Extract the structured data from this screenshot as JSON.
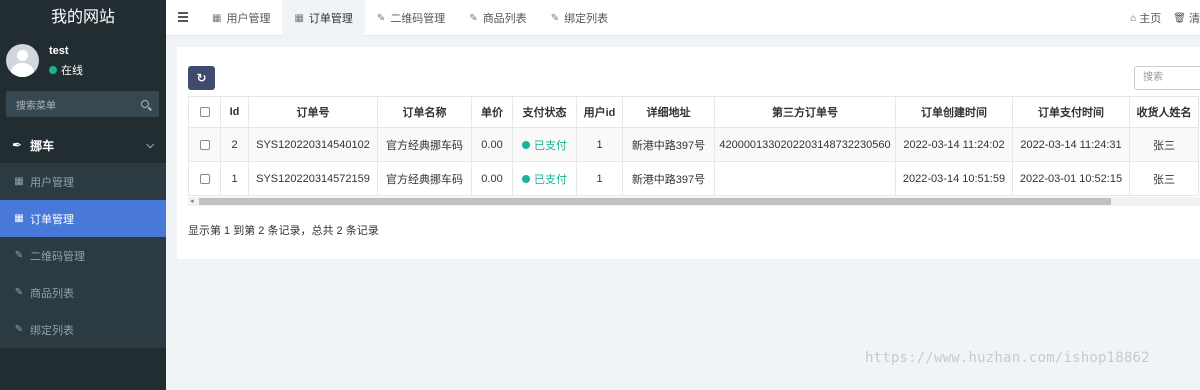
{
  "sidebar": {
    "site_title": "我的网站",
    "user": {
      "name": "test",
      "status": "在线"
    },
    "search_placeholder": "搜索菜单",
    "menu_group": "挪车",
    "items": [
      {
        "label": "用户管理",
        "icon": "table-icon"
      },
      {
        "label": "订单管理",
        "icon": "table-icon",
        "active": true
      },
      {
        "label": "二维码管理",
        "icon": "edit-icon"
      },
      {
        "label": "商品列表",
        "icon": "edit-icon"
      },
      {
        "label": "绑定列表",
        "icon": "edit-icon"
      }
    ]
  },
  "topbar": {
    "tabs": [
      {
        "label": "用户管理",
        "icon": "table-icon"
      },
      {
        "label": "订单管理",
        "icon": "table-icon",
        "active": true
      },
      {
        "label": "二维码管理",
        "icon": "edit-icon"
      },
      {
        "label": "商品列表",
        "icon": "edit-icon"
      },
      {
        "label": "绑定列表",
        "icon": "edit-icon"
      }
    ],
    "home_label": "主页",
    "clear_label": "清"
  },
  "toolbar": {
    "search_placeholder": "搜索"
  },
  "table": {
    "columns": [
      "Id",
      "订单号",
      "订单名称",
      "单价",
      "支付状态",
      "用户id",
      "详细地址",
      "第三方订单号",
      "订单创建时间",
      "订单支付时间",
      "收货人姓名"
    ],
    "rows": [
      [
        "2",
        "SYS120220314540102",
        "官方经典挪车码",
        "0.00",
        "已支付",
        "1",
        "新港中路397号",
        "4200001330202203148732230560",
        "2022-03-14 11:24:02",
        "2022-03-14 11:24:31",
        "张三"
      ],
      [
        "1",
        "SYS120220314572159",
        "官方经典挪车码",
        "0.00",
        "已支付",
        "1",
        "新港中路397号",
        "",
        "2022-03-14 10:51:59",
        "2022-03-01 10:52:15",
        "张三"
      ]
    ]
  },
  "pager": {
    "info": "显示第 1 到第 2 条记录，总共 2 条记录"
  },
  "watermark": "https://www.huzhan.com/ishop18862",
  "colors": {
    "sidebar_bg": "#222d32",
    "active_menu": "#4878d8",
    "paid": "#1ab394",
    "refresh_btn": "#3f4b6e"
  }
}
